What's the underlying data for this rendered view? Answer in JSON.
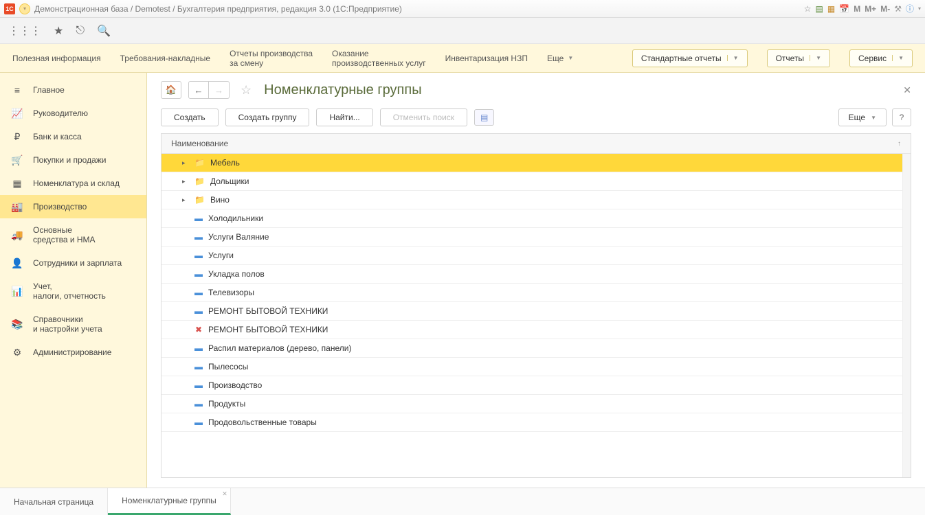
{
  "titlebar": {
    "title": "Демонстрационная база / Demotest / Бухгалтерия предприятия, редакция 3.0  (1С:Предприятие)",
    "m_buttons": [
      "M",
      "M+",
      "M-"
    ]
  },
  "ribbon": {
    "links": [
      "Полезная информация",
      "Требования-накладные",
      "Отчеты производства\nза смену",
      "Оказание\nпроизводственных услуг",
      "Инвентаризация НЗП"
    ],
    "more": "Еще",
    "buttons": {
      "reports_std": "Стандартные отчеты",
      "reports": "Отчеты",
      "service": "Сервис"
    }
  },
  "sidebar": {
    "items": [
      {
        "icon": "≡",
        "label": "Главное"
      },
      {
        "icon": "📈",
        "label": "Руководителю"
      },
      {
        "icon": "₽",
        "label": "Банк и касса"
      },
      {
        "icon": "🛒",
        "label": "Покупки и продажи"
      },
      {
        "icon": "▦",
        "label": "Номенклатура и склад"
      },
      {
        "icon": "🏭",
        "label": "Производство",
        "active": true
      },
      {
        "icon": "🚚",
        "label": "Основные\nсредства и НМА"
      },
      {
        "icon": "👤",
        "label": "Сотрудники и зарплата"
      },
      {
        "icon": "📊",
        "label": "Учет,\nналоги, отчетность"
      },
      {
        "icon": "📚",
        "label": "Справочники\nи настройки учета"
      },
      {
        "icon": "⚙",
        "label": "Администрирование"
      }
    ]
  },
  "page": {
    "title": "Номенклатурные группы",
    "buttons": {
      "create": "Создать",
      "create_group": "Создать группу",
      "find": "Найти...",
      "cancel_search": "Отменить поиск",
      "more": "Еще",
      "help": "?"
    },
    "column_header": "Наименование",
    "rows": [
      {
        "type": "folder",
        "label": "Мебель",
        "selected": true,
        "indent": 1
      },
      {
        "type": "folder",
        "label": "Дольщики",
        "indent": 1
      },
      {
        "type": "folder",
        "label": "Вино",
        "indent": 1
      },
      {
        "type": "item",
        "label": "Холодильники",
        "indent": 2
      },
      {
        "type": "item",
        "label": "Услуги Валяние",
        "indent": 2
      },
      {
        "type": "item",
        "label": "Услуги",
        "indent": 2
      },
      {
        "type": "item",
        "label": "Укладка полов",
        "indent": 2
      },
      {
        "type": "item",
        "label": "Телевизоры",
        "indent": 2
      },
      {
        "type": "item",
        "label": "РЕМОНТ БЫТОВОЙ ТЕХНИКИ",
        "indent": 2
      },
      {
        "type": "item",
        "label": "РЕМОНТ БЫТОВОЙ ТЕХНИКИ",
        "indent": 2,
        "deleted": true
      },
      {
        "type": "item",
        "label": "Распил материалов (дерево, панели)",
        "indent": 2
      },
      {
        "type": "item",
        "label": "Пылесосы",
        "indent": 2
      },
      {
        "type": "item",
        "label": "Производство",
        "indent": 2
      },
      {
        "type": "item",
        "label": "Продукты",
        "indent": 2
      },
      {
        "type": "item",
        "label": "Продовольственные товары",
        "indent": 2
      }
    ]
  },
  "tabs": {
    "items": [
      {
        "label": "Начальная страница"
      },
      {
        "label": "Номенклатурные группы",
        "active": true,
        "closable": true
      }
    ]
  }
}
